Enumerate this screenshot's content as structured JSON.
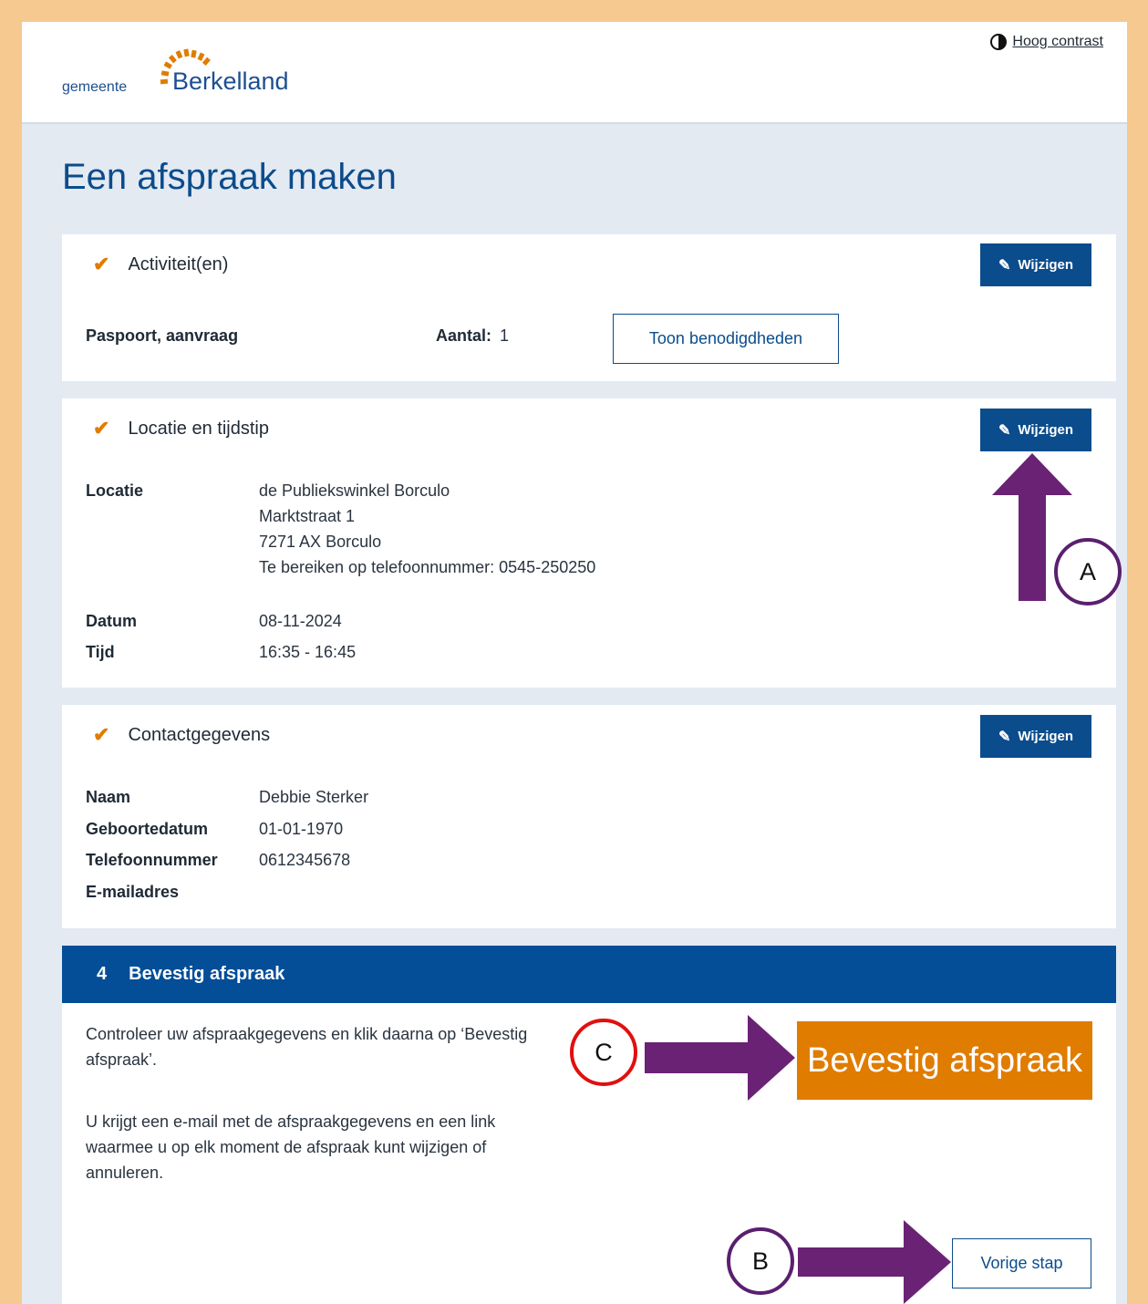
{
  "header": {
    "logo_small": "gemeente",
    "logo_big": "Berkelland",
    "contrast_label": "Hoog contrast"
  },
  "page_title": "Een afspraak maken",
  "edit_label": "Wijzigen",
  "activities": {
    "title": "Activiteit(en)",
    "item": "Paspoort, aanvraag",
    "count_label": "Aantal:",
    "count_value": "1",
    "requirements_button": "Toon benodigdheden"
  },
  "location": {
    "title": "Locatie en tijdstip",
    "location_label": "Locatie",
    "location_lines": [
      "de Publiekswinkel Borculo",
      "Marktstraat 1",
      "7271 AX Borculo",
      "Te bereiken op telefoonnummer: 0545-250250"
    ],
    "date_label": "Datum",
    "date_value": "08-11-2024",
    "time_label": "Tijd",
    "time_value": "16:35 - 16:45"
  },
  "contact": {
    "title": "Contactgegevens",
    "fields": [
      {
        "label": "Naam",
        "value": "Debbie Sterker"
      },
      {
        "label": "Geboortedatum",
        "value": "01-01-1970"
      },
      {
        "label": "Telefoonnummer",
        "value": "0612345678"
      },
      {
        "label": "E-mailadres",
        "value": ""
      }
    ]
  },
  "confirm": {
    "step_number": "4",
    "title": "Bevestig afspraak",
    "text1": "Controleer uw afspraakgegevens en klik daarna op ‘Bevestig afspraak’.",
    "text2": "U krijgt een e-mail met de afspraakgegevens en een link waarmee u op elk moment de afspraak kunt wijzigen of annuleren.",
    "confirm_button": "Bevestig afspraak",
    "previous_button": "Vorige stap"
  },
  "markers": {
    "a": "A",
    "b": "B",
    "c": "C"
  },
  "colors": {
    "primary": "#0b4c8c",
    "accent": "#e07c00",
    "annotation_arrow": "#6a2274",
    "marker_c": "#e0100f",
    "frame": "#f5c990"
  }
}
